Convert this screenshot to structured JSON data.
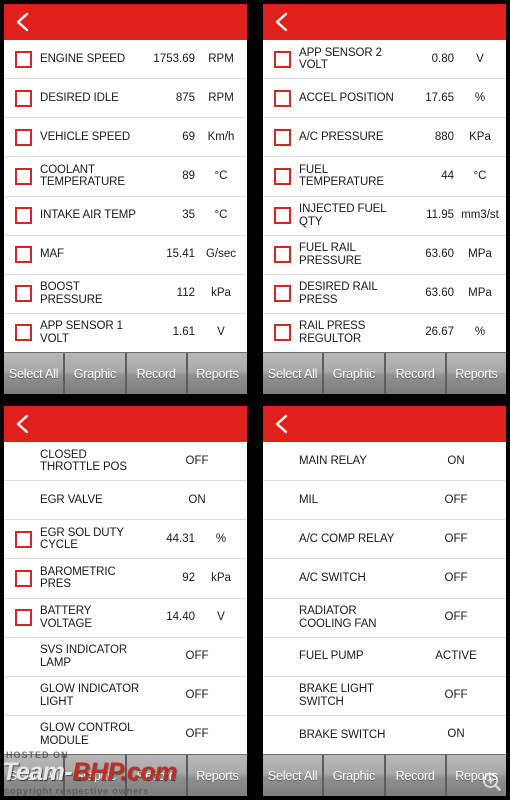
{
  "app": {
    "accent_red": "#e0211b",
    "checkbox_border": "#cf2a22",
    "toolbar_gray": "#a9a9a9",
    "back_icon": "chevron-left-icon",
    "magnifier_icon": "magnifier-plus-icon"
  },
  "toolbar": {
    "select_all": "Select All",
    "graphic": "Graphic",
    "record": "Record",
    "reports": "Reports"
  },
  "watermark": {
    "hosted": "HOSTED ON",
    "team": "Team-",
    "bhp": "BHP.com",
    "copyright": "copyright respective owners"
  },
  "panels": [
    {
      "id": "panel-1",
      "rows": [
        {
          "checkbox": true,
          "label": "ENGINE SPEED",
          "value": "1753.69",
          "unit": "RPM",
          "status": false
        },
        {
          "checkbox": true,
          "label": "DESIRED IDLE",
          "value": "875",
          "unit": "RPM",
          "status": false
        },
        {
          "checkbox": true,
          "label": "VEHICLE SPEED",
          "value": "69",
          "unit": "Km/h",
          "status": false
        },
        {
          "checkbox": true,
          "label": "COOLANT TEMPERATURE",
          "value": "89",
          "unit": "°C",
          "status": false
        },
        {
          "checkbox": true,
          "label": "INTAKE AIR TEMP",
          "value": "35",
          "unit": "°C",
          "status": false
        },
        {
          "checkbox": true,
          "label": "MAF",
          "value": "15.41",
          "unit": "G/sec",
          "status": false
        },
        {
          "checkbox": true,
          "label": "BOOST PRESSURE",
          "value": "112",
          "unit": "kPa",
          "status": false
        },
        {
          "checkbox": true,
          "label": "APP SENSOR 1 VOLT",
          "value": "1.61",
          "unit": "V",
          "status": false
        }
      ]
    },
    {
      "id": "panel-2",
      "rows": [
        {
          "checkbox": true,
          "label": "APP SENSOR 2 VOLT",
          "value": "0.80",
          "unit": "V",
          "status": false
        },
        {
          "checkbox": true,
          "label": "ACCEL POSITION",
          "value": "17.65",
          "unit": "%",
          "status": false
        },
        {
          "checkbox": true,
          "label": "A/C PRESSURE",
          "value": "880",
          "unit": "KPa",
          "status": false
        },
        {
          "checkbox": true,
          "label": "FUEL TEMPERATURE",
          "value": "44",
          "unit": "°C",
          "status": false
        },
        {
          "checkbox": true,
          "label": "INJECTED FUEL QTY",
          "value": "11.95",
          "unit": "mm3/st",
          "status": false
        },
        {
          "checkbox": true,
          "label": "FUEL RAIL PRESSURE",
          "value": "63.60",
          "unit": "MPa",
          "status": false
        },
        {
          "checkbox": true,
          "label": "DESIRED RAIL PRESS",
          "value": "63.60",
          "unit": "MPa",
          "status": false
        },
        {
          "checkbox": true,
          "label": "RAIL PRESS REGULTOR",
          "value": "26.67",
          "unit": "%",
          "status": false
        }
      ]
    },
    {
      "id": "panel-3",
      "rows": [
        {
          "checkbox": false,
          "label": "CLOSED THROTTLE POS",
          "value": "OFF",
          "unit": "",
          "status": true
        },
        {
          "checkbox": false,
          "label": "EGR VALVE",
          "value": "ON",
          "unit": "",
          "status": true
        },
        {
          "checkbox": true,
          "label": "EGR SOL DUTY CYCLE",
          "value": "44.31",
          "unit": "%",
          "status": false
        },
        {
          "checkbox": true,
          "label": "BAROMETRIC PRES",
          "value": "92",
          "unit": "kPa",
          "status": false
        },
        {
          "checkbox": true,
          "label": "BATTERY VOLTAGE",
          "value": "14.40",
          "unit": "V",
          "status": false
        },
        {
          "checkbox": false,
          "label": "SVS INDICATOR LAMP",
          "value": "OFF",
          "unit": "",
          "status": true
        },
        {
          "checkbox": false,
          "label": "GLOW INDICATOR LIGHT",
          "value": "OFF",
          "unit": "",
          "status": true
        },
        {
          "checkbox": false,
          "label": "GLOW CONTROL MODULE",
          "value": "OFF",
          "unit": "",
          "status": true
        }
      ]
    },
    {
      "id": "panel-4",
      "rows": [
        {
          "checkbox": false,
          "label": "MAIN RELAY",
          "value": "ON",
          "unit": "",
          "status": true
        },
        {
          "checkbox": false,
          "label": "MIL",
          "value": "OFF",
          "unit": "",
          "status": true
        },
        {
          "checkbox": false,
          "label": "A/C COMP RELAY",
          "value": "OFF",
          "unit": "",
          "status": true
        },
        {
          "checkbox": false,
          "label": "A/C SWITCH",
          "value": "OFF",
          "unit": "",
          "status": true
        },
        {
          "checkbox": false,
          "label": "RADIATOR COOLING FAN",
          "value": "OFF",
          "unit": "",
          "status": true
        },
        {
          "checkbox": false,
          "label": "FUEL PUMP",
          "value": "ACTIVE",
          "unit": "",
          "status": true
        },
        {
          "checkbox": false,
          "label": "BRAKE LIGHT SWITCH",
          "value": "OFF",
          "unit": "",
          "status": true
        },
        {
          "checkbox": false,
          "label": "BRAKE SWITCH",
          "value": "ON",
          "unit": "",
          "status": true
        }
      ]
    }
  ]
}
